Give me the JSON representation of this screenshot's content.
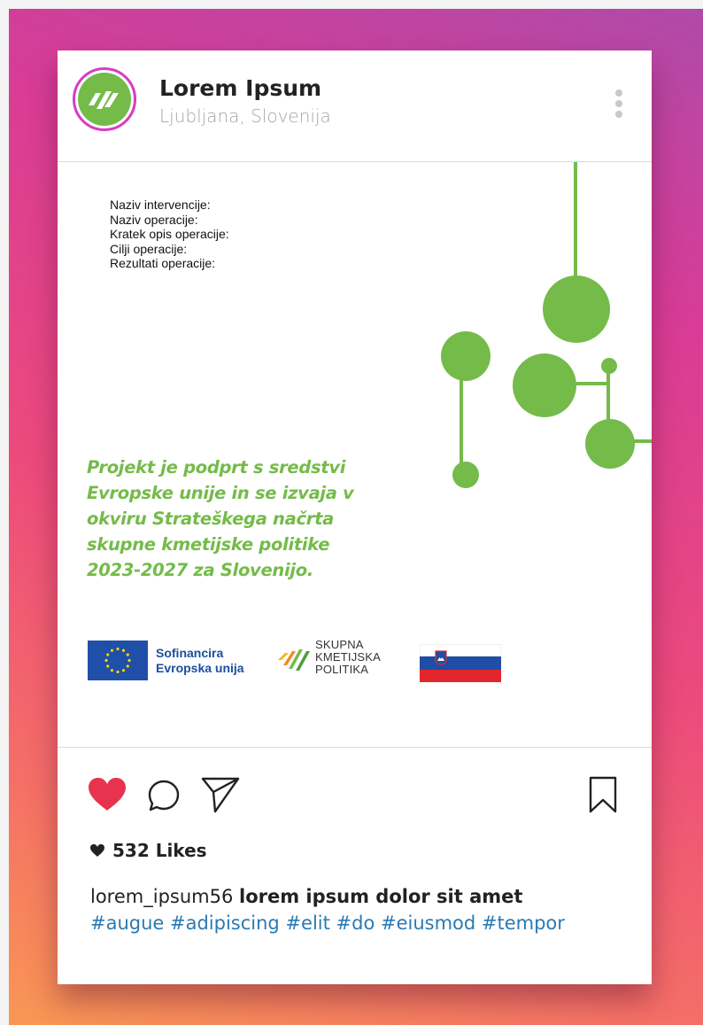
{
  "post": {
    "username": "Lorem Ipsum",
    "location": "Ljubljana, Slovenija",
    "fields": [
      "Naziv intervencije:",
      "Naziv operacije:",
      "Kratek opis operacije:",
      "Cilji  operacije:",
      "Rezultati operacije:"
    ],
    "statement_lines": [
      "Projekt je podprt s sredstvi",
      "Evropske unije in se izvaja v",
      "okviru Strateškega načrta",
      "skupne kmetijske politike",
      "2023-2027 za Slovenijo."
    ],
    "logos": {
      "eu_line1": "Sofinancira",
      "eu_line2": "Evropska unija",
      "skp_line1": "SKUPNA",
      "skp_line2": "KMETIJSKA",
      "skp_line3": "POLITIKA"
    },
    "likes": "532 Likes",
    "caption_user": "lorem_ipsum56",
    "caption_text": "lorem ipsum dolor sit amet",
    "hashtags": "#augue  #adipiscing #elit #do #eiusmod #tempor"
  },
  "colors": {
    "accent_green": "#74bb49",
    "heart_red": "#e8334f",
    "hashtag_blue": "#2a7ab3",
    "avatar_ring": "#d83cc3"
  },
  "icons": [
    "more-vertical-icon",
    "heart-icon",
    "comment-icon",
    "share-icon",
    "bookmark-icon"
  ]
}
